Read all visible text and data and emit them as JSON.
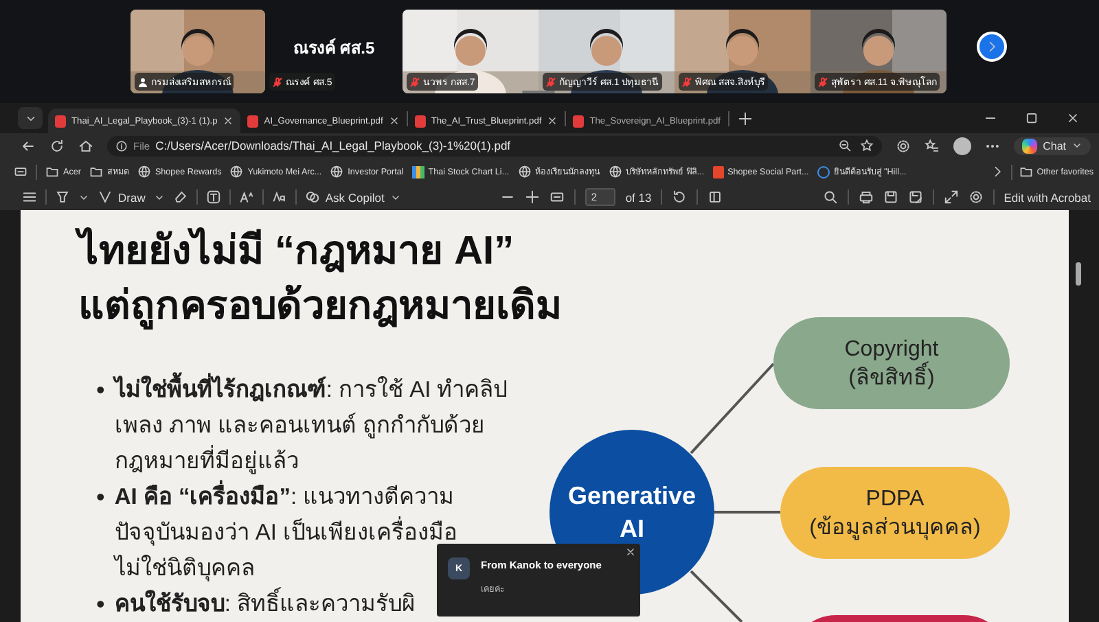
{
  "meeting": {
    "participants": [
      {
        "kind": "video",
        "name": "กรมส่งเสริมสหกรณ์",
        "speaking": true,
        "muted": false
      },
      {
        "kind": "name",
        "title": "ณรงค์ ศส.5",
        "name": "ณรงค์ ศส.5",
        "speaking": false,
        "muted": true
      },
      {
        "kind": "video",
        "name": "นวพร กสส.7",
        "speaking": false,
        "muted": true
      },
      {
        "kind": "video",
        "name": "กัญญาวีร์ ศส.1 ปทุมธานี",
        "speaking": false,
        "muted": true
      },
      {
        "kind": "video",
        "name": "พิศณ สสจ.สิงห์บุรี",
        "speaking": false,
        "muted": true
      },
      {
        "kind": "video",
        "name": "สุพัตรา ศส.11 จ.พิษณุโลก",
        "speaking": false,
        "muted": true
      }
    ]
  },
  "browser": {
    "tabs": [
      {
        "label": "Thai_AI_Legal_Playbook_(3)-1 (1).p",
        "selected": true
      },
      {
        "label": "AI_Governance_Blueprint.pdf",
        "selected": false
      },
      {
        "label": "The_AI_Trust_Blueprint.pdf",
        "selected": false
      },
      {
        "label": "The_Sovereign_AI_Blueprint.pdf",
        "selected": false
      }
    ],
    "address": {
      "scheme": "File",
      "url": "C:/Users/Acer/Downloads/Thai_AI_Legal_Playbook_(3)-1%20(1).pdf"
    },
    "chat_button": "Chat",
    "bookmarks": [
      {
        "label": "Acer",
        "kind": "folder"
      },
      {
        "label": "สหมด",
        "kind": "folder"
      },
      {
        "label": "Shopee Rewards",
        "kind": "globe"
      },
      {
        "label": "Yukimoto Mei Arc...",
        "kind": "globe"
      },
      {
        "label": "Investor Portal",
        "kind": "globe"
      },
      {
        "label": "Thai Stock Chart Li...",
        "kind": "chart"
      },
      {
        "label": "ห้องเรียนนักลงทุน",
        "kind": "globe"
      },
      {
        "label": "บริษัทหลักทรัพย์ ฟิลิ...",
        "kind": "globe"
      },
      {
        "label": "Shopee Social Part...",
        "kind": "bag"
      },
      {
        "label": "ยินดีต้อนรับสู่ \"Hill...",
        "kind": "ring"
      }
    ],
    "other_favorites": "Other favorites"
  },
  "pdf_toolbar": {
    "draw": "Draw",
    "copilot": "Ask Copilot",
    "page": "2",
    "page_count": "of 13",
    "edit": "Edit with Acrobat"
  },
  "slide": {
    "title_lines": [
      "ไทยยังไม่มี “กฎหมาย AI”",
      "แต่ถูกครอบด้วยกฎหมายเดิม"
    ],
    "bullets": [
      {
        "marker": "•",
        "lines": [
          "**ไม่ใช่พื้นที่ไร้กฎเกณฑ์**: การใช้ AI ทำคลิป",
          "เพลง ภาพ และคอนเทนต์ ถูกกำกับด้วย",
          "กฎหมายที่มีอยู่แล้ว"
        ]
      },
      {
        "marker": "•",
        "lines": [
          "**AI คือ “เครื่องมือ”**: แนวทางตีความ",
          "ปัจจุบันมองว่า AI เป็นเพียงเครื่องมือ",
          "ไม่ใช่นิติบุคคล"
        ]
      },
      {
        "marker": "•",
        "lines": [
          "**คนใช้รับจบ**: สิทธิ์และความรับผิ"
        ]
      }
    ],
    "center_lines": [
      "Generative",
      "AI"
    ],
    "nodes": [
      {
        "lines": [
          "Copyright",
          "(ลิขสิทธิ์)"
        ],
        "color": "#8aa88c"
      },
      {
        "lines": [
          "PDPA",
          "(ข้อมูลส่วนบุคคล)"
        ],
        "color": "#f2bb48"
      },
      {
        "color": "#c8254a"
      }
    ]
  },
  "chat_popup": {
    "initial": "K",
    "title": "From Kanok to everyone",
    "message": "เคยค่ะ"
  }
}
